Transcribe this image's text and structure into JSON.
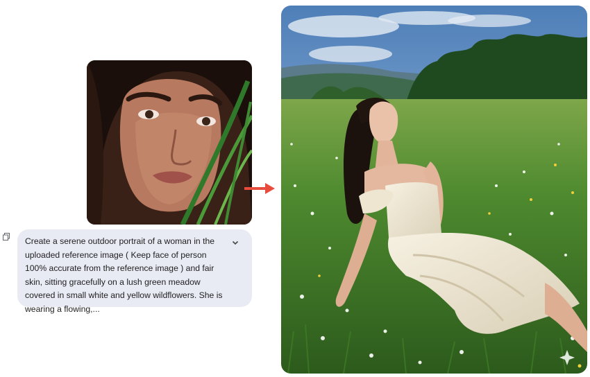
{
  "reference_image": {
    "alt": "Close-up portrait of a woman with long dark hair behind green grass blades"
  },
  "prompt": {
    "text": "Create a serene outdoor portrait of a woman in the uploaded reference image ( Keep face of person 100% accurate from the reference image ) and fair skin, sitting gracefully on a lush green meadow covered in small white and yellow wildflowers. She is wearing a flowing,..."
  },
  "icons": {
    "copy": "copy-icon",
    "expand": "chevron-down-icon",
    "arrow": "arrow-right-icon"
  },
  "colors": {
    "bubble_bg": "#e8eaf4",
    "arrow": "#e84c3d",
    "text": "#1f1f1f"
  },
  "result_image": {
    "alt": "Woman in a white satin dress sitting in a green meadow with wildflowers, eyes closed, under a blue sky with hills and trees"
  }
}
